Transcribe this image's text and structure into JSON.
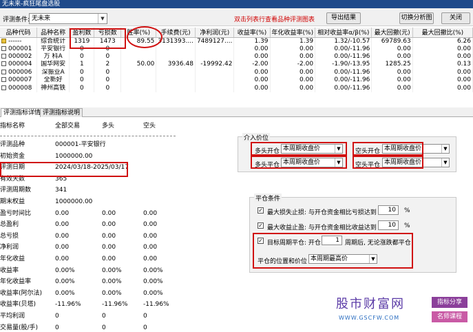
{
  "window": {
    "title": "无未来-疯狂尾盘选股"
  },
  "toolbar": {
    "eval_label": "评测条件:",
    "eval_value": "无未来",
    "hint": "双击列表行查看品种评测图表",
    "export_btn": "导出结果",
    "switch_btn": "切换分析图",
    "close_btn": "关闭"
  },
  "grid": {
    "columns": [
      "品种代码",
      "品种名称",
      "盈利数",
      "亏损数",
      "胜率(%)",
      "手续费(元)",
      "净利润(元)",
      "收益率(%)",
      "年化收益率(%)",
      "相对收益率α/β(%)",
      "最大回撤(元)",
      "最大回撤比(%)"
    ],
    "rows": [
      {
        "code": "------",
        "name": "综合统计",
        "win": "1319",
        "loss": "1473",
        "rate": "89.55",
        "fee": "3131393....",
        "profit": "7489127....",
        "ret": "1.39",
        "annual": "1.39",
        "rel": "1.32/-10.57",
        "dd": "69789.63",
        "ddr": "6.26",
        "icon": "folder"
      },
      {
        "code": "000001",
        "name": "平安银行",
        "win": "0",
        "loss": "0",
        "rate": "",
        "fee": "",
        "profit": "",
        "ret": "0.00",
        "annual": "0.00",
        "rel": "0.00/-11.96",
        "dd": "0.00",
        "ddr": "0.00",
        "icon": "box"
      },
      {
        "code": "000002",
        "name": "万 科A",
        "win": "0",
        "loss": "0",
        "rate": "",
        "fee": "",
        "profit": "",
        "ret": "0.00",
        "annual": "0.00",
        "rel": "0.00/-11.96",
        "dd": "0.00",
        "ddr": "0.00",
        "icon": "box"
      },
      {
        "code": "000004",
        "name": "国华网安",
        "win": "1",
        "loss": "2",
        "rate": "50.00",
        "fee": "3936.48",
        "profit": "-19992.42",
        "ret": "-2.00",
        "annual": "-2.00",
        "rel": "-1.90/-13.95",
        "dd": "1285.25",
        "ddr": "0.13",
        "icon": "box"
      },
      {
        "code": "000006",
        "name": "深振业A",
        "win": "0",
        "loss": "0",
        "rate": "",
        "fee": "",
        "profit": "",
        "ret": "0.00",
        "annual": "0.00",
        "rel": "0.00/-11.96",
        "dd": "0.00",
        "ddr": "0.00",
        "icon": "box"
      },
      {
        "code": "000007",
        "name": "全新好",
        "win": "0",
        "loss": "0",
        "rate": "",
        "fee": "",
        "profit": "",
        "ret": "0.00",
        "annual": "0.00",
        "rel": "0.00/-11.96",
        "dd": "0.00",
        "ddr": "0.00",
        "icon": "box"
      },
      {
        "code": "000008",
        "name": "神州高铁",
        "win": "0",
        "loss": "0",
        "rate": "",
        "fee": "",
        "profit": "",
        "ret": "0.00",
        "annual": "0.00",
        "rel": "0.00/-11.96",
        "dd": "0.00",
        "ddr": "0.00",
        "icon": "box"
      }
    ]
  },
  "tabs": [
    "评测指标详情",
    "评测指标说明"
  ],
  "detail": {
    "headers": [
      "指标名称",
      "全部交易",
      "多头",
      "空头"
    ],
    "rows": [
      {
        "k": "评测品种",
        "v": "000001-平安银行",
        "l": "",
        "s": ""
      },
      {
        "k": "初始资金",
        "v": "1000000.00",
        "l": "",
        "s": ""
      },
      {
        "k": "评测日期",
        "v": "2024/03/18-2025/03/17",
        "l": "",
        "s": ""
      },
      {
        "k": "有效天数",
        "v": "365",
        "l": "",
        "s": ""
      },
      {
        "k": "评测周期数",
        "v": "341",
        "l": "",
        "s": ""
      },
      {
        "k": "期末权益",
        "v": "1000000.00",
        "l": "",
        "s": ""
      },
      {
        "k": "盈亏时间比",
        "v": "0.00",
        "l": "0.00",
        "s": "0.00"
      },
      {
        "k": "总盈利",
        "v": "0.00",
        "l": "0.00",
        "s": "0.00"
      },
      {
        "k": "总亏损",
        "v": "0.00",
        "l": "0.00",
        "s": "0.00"
      },
      {
        "k": "净利润",
        "v": "0.00",
        "l": "0.00",
        "s": "0.00"
      },
      {
        "k": "年化收益",
        "v": "0.00",
        "l": "0.00",
        "s": "0.00"
      },
      {
        "k": "收益率",
        "v": "0.00%",
        "l": "0.00%",
        "s": "0.00%"
      },
      {
        "k": "年化收益率",
        "v": "0.00%",
        "l": "0.00%",
        "s": "0.00%"
      },
      {
        "k": "收益率(阿尔法)",
        "v": "0.00%",
        "l": "0.00%",
        "s": "0.00%"
      },
      {
        "k": "收益率(贝塔)",
        "v": "-11.96%",
        "l": "-11.96%",
        "s": "-11.96%"
      },
      {
        "k": "平均利润",
        "v": "0",
        "l": "0",
        "s": "0"
      },
      {
        "k": "交易量(股/手)",
        "v": "0",
        "l": "0",
        "s": "0"
      }
    ]
  },
  "entry": {
    "legend": "介入价位",
    "long_open_label": "多头开仓",
    "long_open_value": "本周期收盘价",
    "short_open_label": "空头开仓",
    "short_open_value": "本周期收盘价",
    "long_close_label": "多头平仓",
    "long_close_value": "本周期收盘价",
    "short_close_label": "空头平仓",
    "short_close_value": "本周期收盘价"
  },
  "close_cond": {
    "legend": "平仓条件",
    "stop_loss_label": "最大损失止损: 与开仓资金相比亏损达到",
    "stop_loss_value": "10",
    "take_profit_label": "最大收益止盈: 与开仓资金相比收益达到",
    "take_profit_value": "10",
    "pct": "%",
    "target_label": "目标周期平仓: 开仓",
    "target_value": "1",
    "target_suffix": "周期后, 无论涨跌都平仓",
    "pos_label": "平仓的位置和价位",
    "pos_value": "本周期最高价"
  },
  "watermark": {
    "title": "股市财富网",
    "url": "WWW.GSCFW.COM",
    "tag1": "指标分享",
    "tag2": "名师课程"
  },
  "colors": {
    "highlight": "#d01010",
    "titlebar": "#1f4a8a",
    "hint": "#d00000",
    "watermark": "#5a3aa6"
  }
}
